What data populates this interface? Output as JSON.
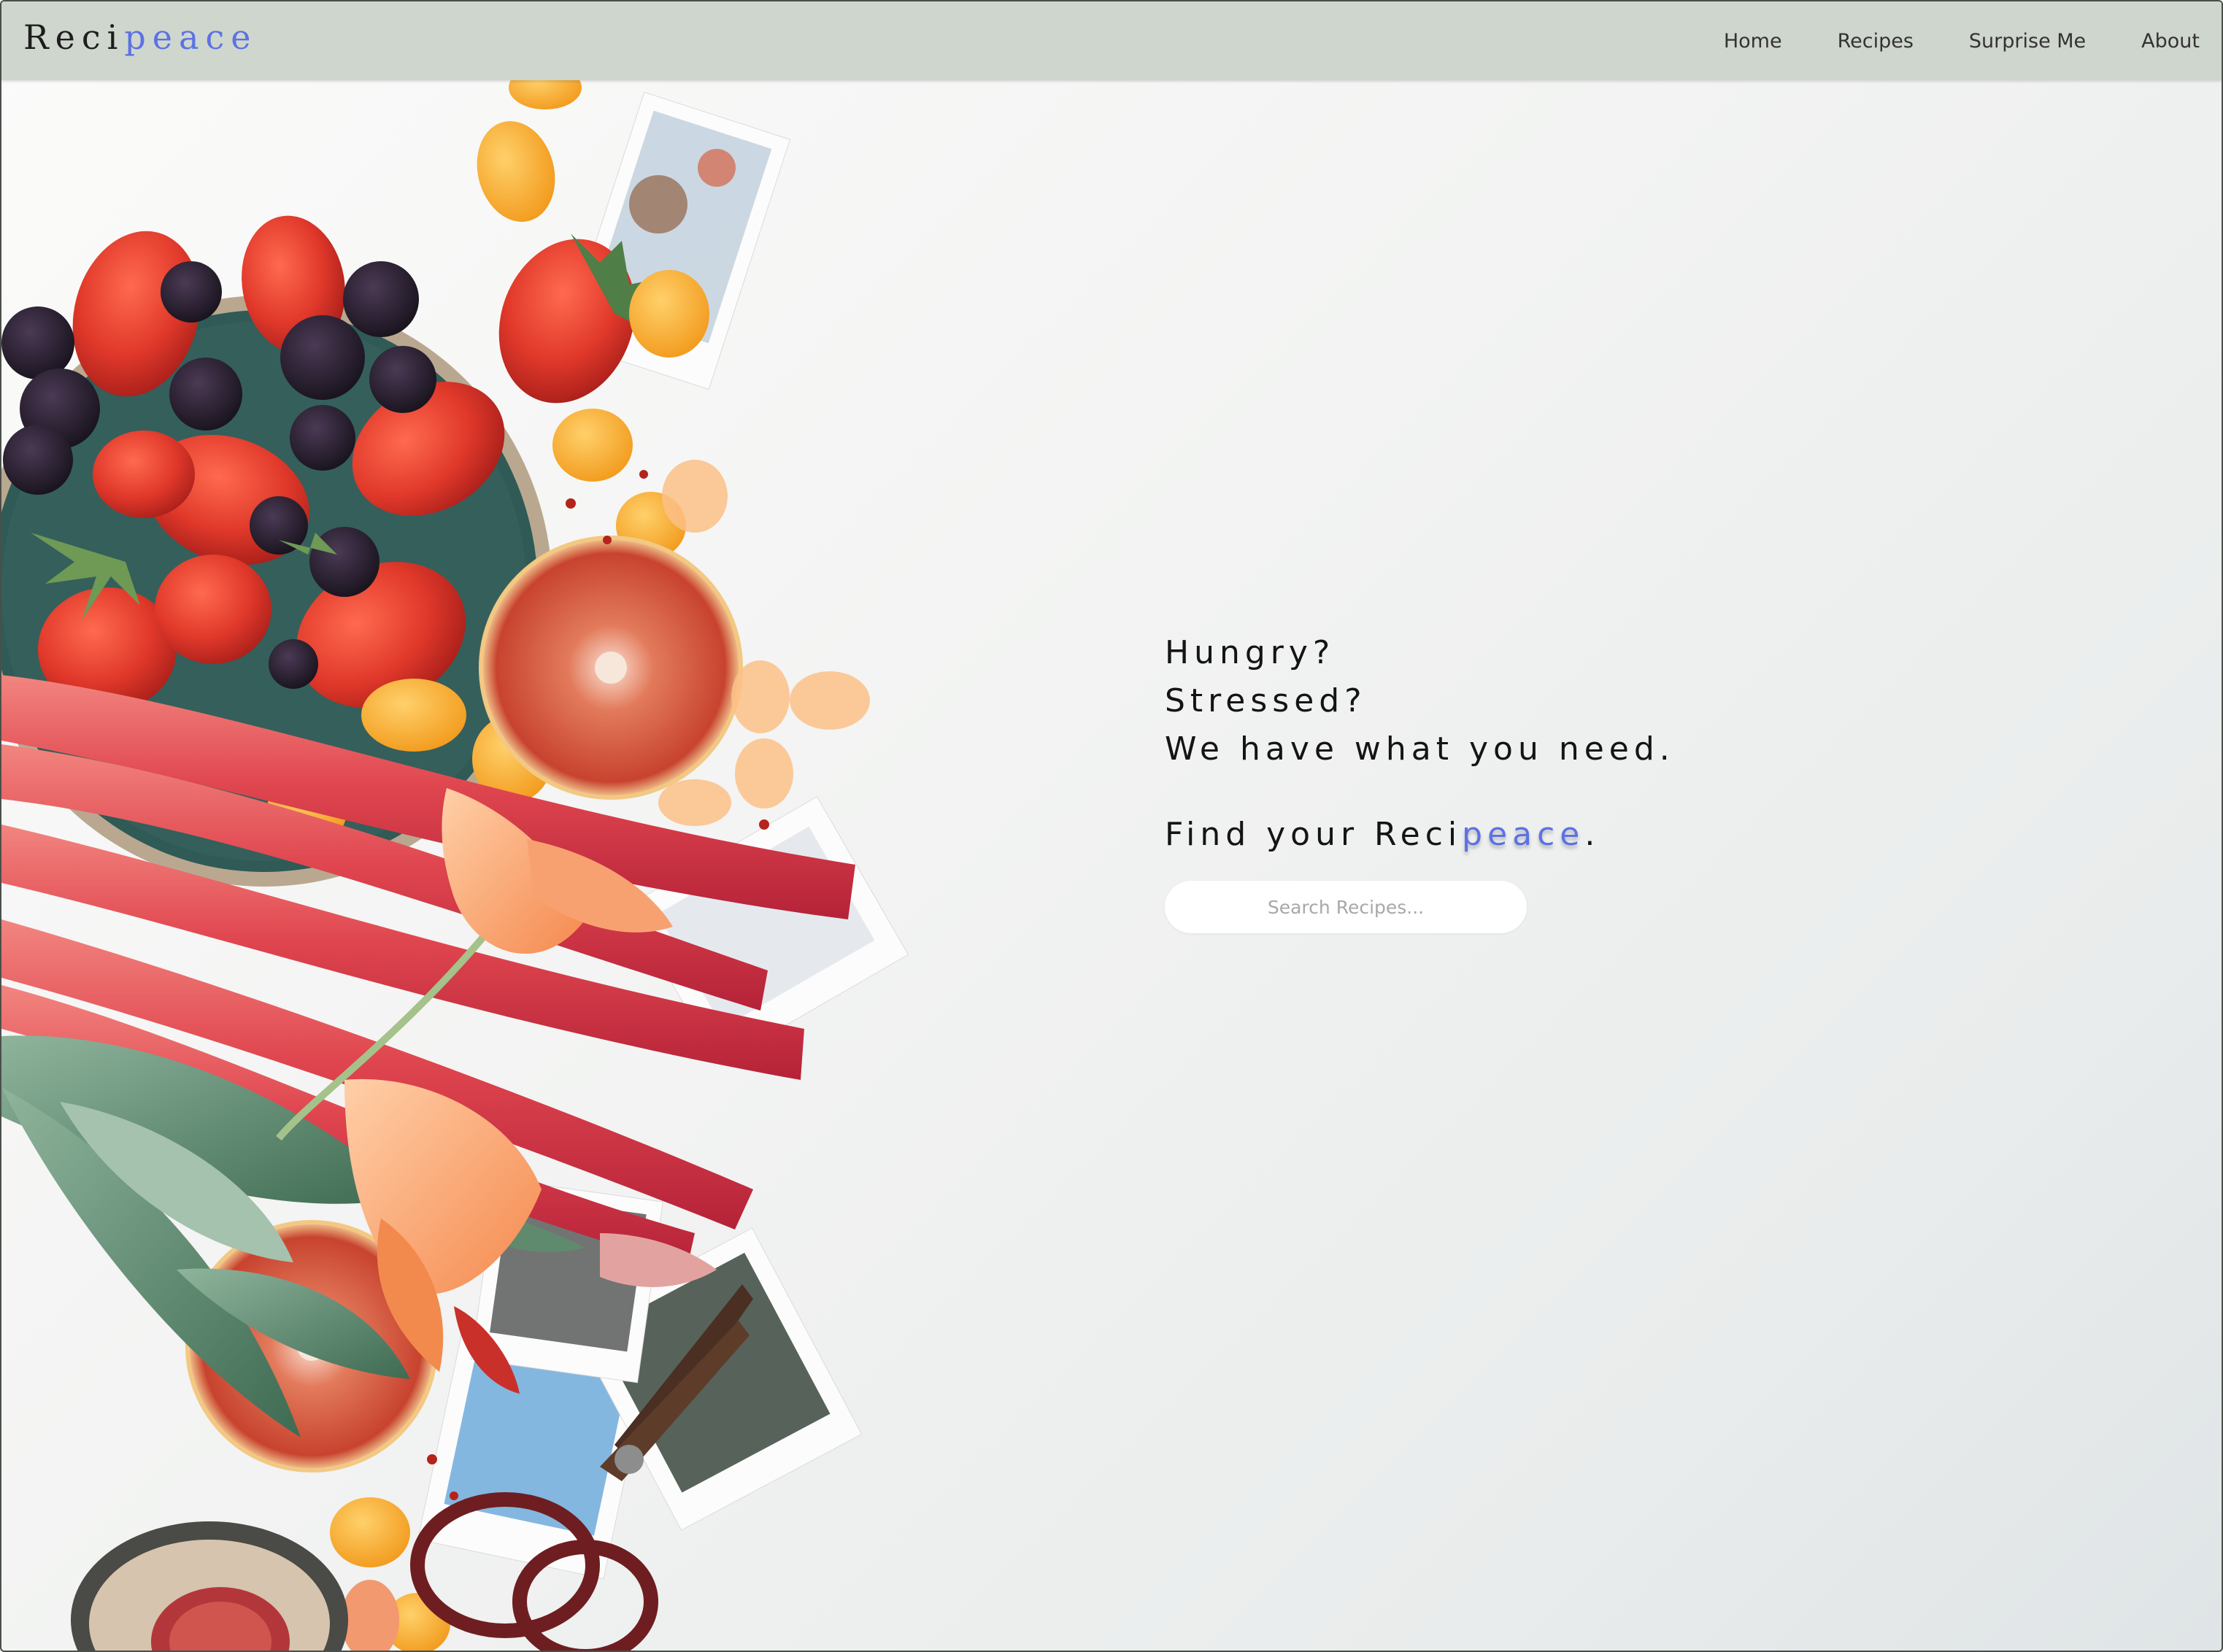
{
  "brand": {
    "prefix": "Reci",
    "accent": "peace",
    "accent_color": "#5c72e3"
  },
  "nav": {
    "items": [
      {
        "label": "Home"
      },
      {
        "label": "Recipes"
      },
      {
        "label": "Surprise Me"
      },
      {
        "label": "About"
      }
    ],
    "background": "#cfd6cd"
  },
  "hero": {
    "lines": [
      "Hungry?",
      "Stressed?",
      "We have what you need."
    ],
    "cta_prefix": "Find your Reci",
    "cta_accent": "peace",
    "cta_suffix": "."
  },
  "search": {
    "placeholder": "Search Recipes...",
    "value": ""
  },
  "background_image": {
    "icon": "food-flatlay-image"
  }
}
